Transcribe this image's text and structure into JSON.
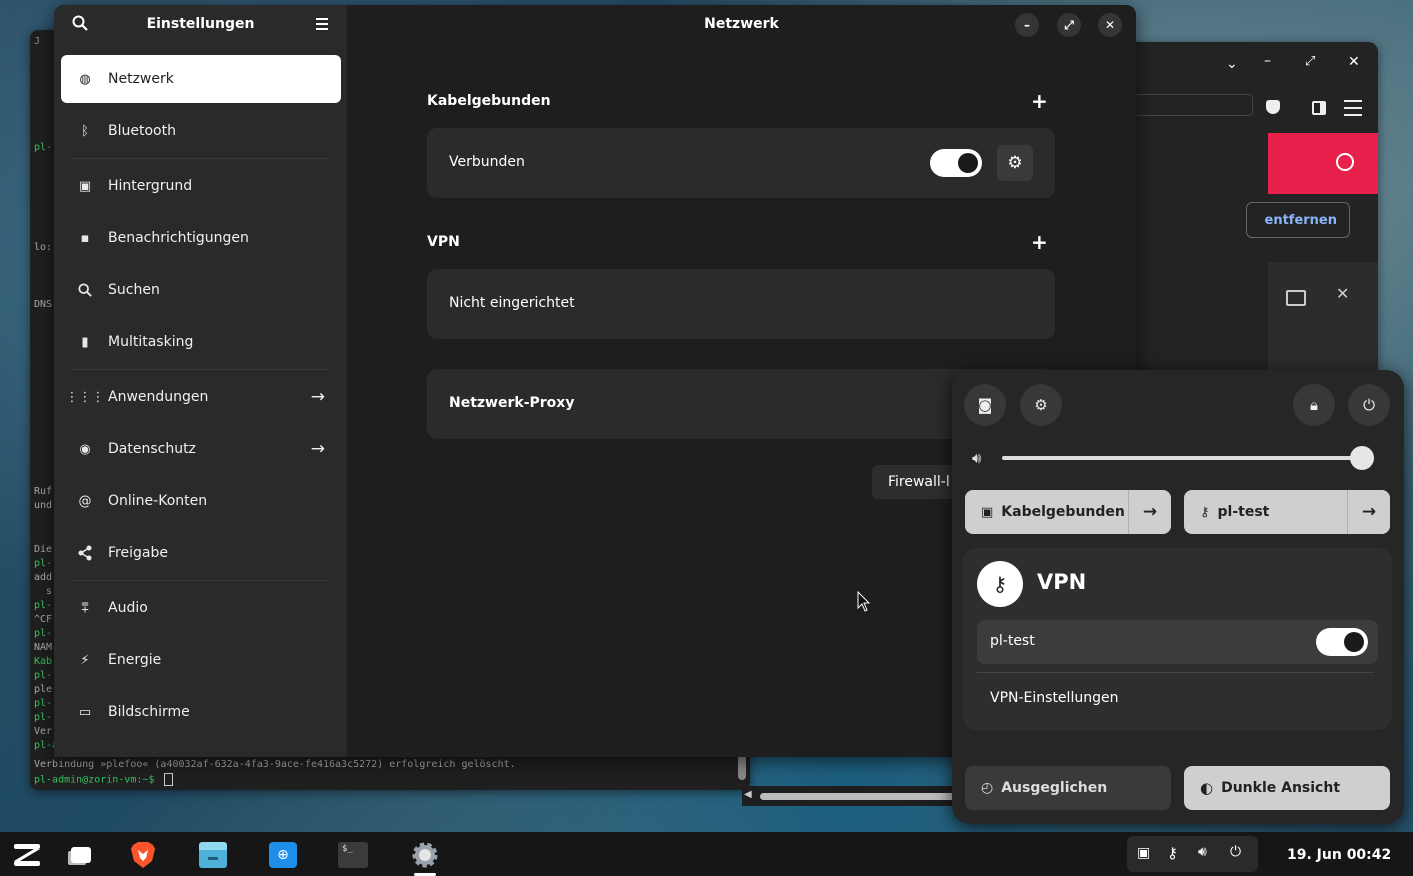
{
  "terminal": {
    "line1": "Verbindung »plefoo« (a40032af-632a-4fa3-9ace-fe416a3c5272) erfolgreich gelöscht.",
    "prompt": "pl-admin@zorin-vm:~$",
    "sidefrag": [
      "pl-",
      "lo:",
      "DNS",
      "Ruf",
      "und",
      "Die",
      "pl-",
      "add",
      "s",
      "pl-",
      "^CF",
      "pl-",
      "NAM",
      "Kab",
      "pl-",
      "ple",
      "pl-",
      "pl-",
      "Ver",
      "pl-a"
    ]
  },
  "browser": {
    "remove_label": "entfernen"
  },
  "settings": {
    "sidebar_title": "Einstellungen",
    "main_title": "Netzwerk",
    "sidebar": {
      "items": [
        {
          "label": "Netzwerk"
        },
        {
          "label": "Bluetooth"
        },
        {
          "label": "Hintergrund"
        },
        {
          "label": "Benachrichtigungen"
        },
        {
          "label": "Suchen"
        },
        {
          "label": "Multitasking"
        },
        {
          "label": "Anwendungen"
        },
        {
          "label": "Datenschutz"
        },
        {
          "label": "Online-Konten"
        },
        {
          "label": "Freigabe"
        },
        {
          "label": "Audio"
        },
        {
          "label": "Energie"
        },
        {
          "label": "Bildschirme"
        }
      ]
    },
    "wired": {
      "title": "Kabelgebunden",
      "status": "Verbunden",
      "toggle_on": true
    },
    "vpn": {
      "title": "VPN",
      "status": "Nicht eingerichtet"
    },
    "proxy": {
      "title": "Netzwerk-Proxy"
    },
    "firewall_label": "Firewall-l"
  },
  "quick_settings": {
    "volume_percent": 100,
    "wired_label": "Kabelgebunden",
    "vpn_pill_label": "pl-test",
    "vpn_panel_title": "VPN",
    "vpn_connection": "pl-test",
    "vpn_connection_on": true,
    "vpn_settings_label": "VPN-Einstellungen",
    "power_mode_label": "Ausgeglichen",
    "dark_mode_label": "Dunkle Ansicht"
  },
  "taskbar": {
    "clock": "19. Jun  00:42"
  },
  "colors": {
    "accent_red": "#e8204b",
    "pill_active": "#cfcfcf",
    "pill_inactive": "#3a3a3a"
  }
}
